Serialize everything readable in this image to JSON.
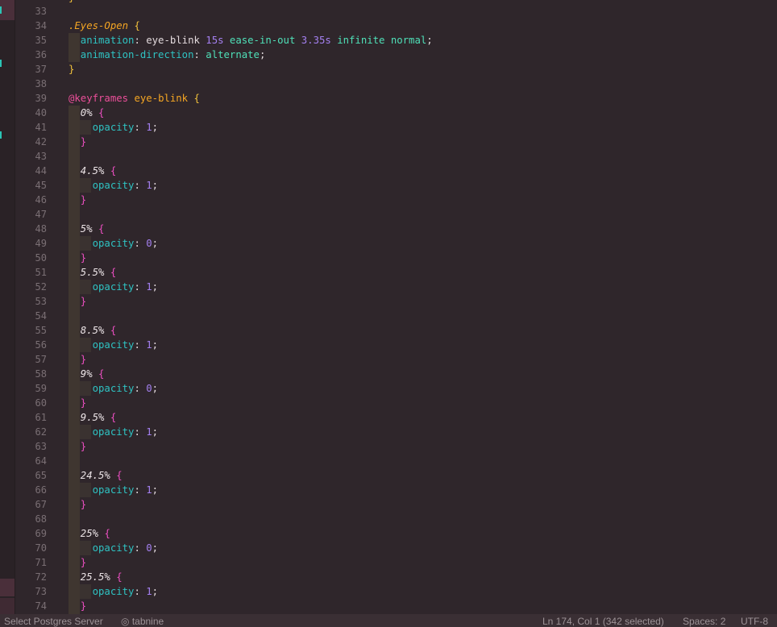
{
  "editor": {
    "lines": [
      {
        "n": "33",
        "tokens": []
      },
      {
        "n": "34",
        "tokens": [
          {
            "t": ".Eyes-Open",
            "c": "sel"
          },
          {
            "t": " ",
            "c": "plain"
          },
          {
            "t": "{",
            "c": "brace-y"
          }
        ]
      },
      {
        "n": "35",
        "tokens": [
          {
            "t": "  animation",
            "c": "prop"
          },
          {
            "t": ": ",
            "c": "punct"
          },
          {
            "t": "eye-blink ",
            "c": "plain"
          },
          {
            "t": "15s",
            "c": "num"
          },
          {
            "t": " ",
            "c": "plain"
          },
          {
            "t": "ease-in-out",
            "c": "kw"
          },
          {
            "t": " ",
            "c": "plain"
          },
          {
            "t": "3.35s",
            "c": "num"
          },
          {
            "t": " ",
            "c": "plain"
          },
          {
            "t": "infinite",
            "c": "kw"
          },
          {
            "t": " ",
            "c": "plain"
          },
          {
            "t": "normal",
            "c": "kw"
          },
          {
            "t": ";",
            "c": "punct"
          }
        ]
      },
      {
        "n": "36",
        "tokens": [
          {
            "t": "  animation-direction",
            "c": "prop"
          },
          {
            "t": ": ",
            "c": "punct"
          },
          {
            "t": "alternate",
            "c": "kw"
          },
          {
            "t": ";",
            "c": "punct"
          }
        ]
      },
      {
        "n": "37",
        "tokens": [
          {
            "t": "}",
            "c": "brace-y"
          }
        ]
      },
      {
        "n": "38",
        "tokens": []
      },
      {
        "n": "39",
        "tokens": [
          {
            "t": "@keyframes",
            "c": "at"
          },
          {
            "t": " ",
            "c": "plain"
          },
          {
            "t": "eye-blink",
            "c": "name"
          },
          {
            "t": " ",
            "c": "plain"
          },
          {
            "t": "{",
            "c": "brace-y"
          }
        ]
      },
      {
        "n": "40",
        "tokens": [
          {
            "t": "  0",
            "c": "pct"
          },
          {
            "t": "%",
            "c": "pct-sym"
          },
          {
            "t": " ",
            "c": "plain"
          },
          {
            "t": "{",
            "c": "brace-p"
          }
        ]
      },
      {
        "n": "41",
        "tokens": [
          {
            "t": "    opacity",
            "c": "prop"
          },
          {
            "t": ": ",
            "c": "punct"
          },
          {
            "t": "1",
            "c": "num"
          },
          {
            "t": ";",
            "c": "punct"
          }
        ]
      },
      {
        "n": "42",
        "tokens": [
          {
            "t": "  }",
            "c": "brace-p"
          }
        ]
      },
      {
        "n": "43",
        "tokens": []
      },
      {
        "n": "44",
        "tokens": [
          {
            "t": "  4.5",
            "c": "pct"
          },
          {
            "t": "%",
            "c": "pct-sym"
          },
          {
            "t": " ",
            "c": "plain"
          },
          {
            "t": "{",
            "c": "brace-p"
          }
        ]
      },
      {
        "n": "45",
        "tokens": [
          {
            "t": "    opacity",
            "c": "prop"
          },
          {
            "t": ": ",
            "c": "punct"
          },
          {
            "t": "1",
            "c": "num"
          },
          {
            "t": ";",
            "c": "punct"
          }
        ]
      },
      {
        "n": "46",
        "tokens": [
          {
            "t": "  }",
            "c": "brace-p"
          }
        ]
      },
      {
        "n": "47",
        "tokens": []
      },
      {
        "n": "48",
        "tokens": [
          {
            "t": "  5",
            "c": "pct"
          },
          {
            "t": "%",
            "c": "pct-sym"
          },
          {
            "t": " ",
            "c": "plain"
          },
          {
            "t": "{",
            "c": "brace-p"
          }
        ]
      },
      {
        "n": "49",
        "tokens": [
          {
            "t": "    opacity",
            "c": "prop"
          },
          {
            "t": ": ",
            "c": "punct"
          },
          {
            "t": "0",
            "c": "num"
          },
          {
            "t": ";",
            "c": "punct"
          }
        ]
      },
      {
        "n": "50",
        "tokens": [
          {
            "t": "  }",
            "c": "brace-p"
          }
        ]
      },
      {
        "n": "51",
        "tokens": [
          {
            "t": "  5.5",
            "c": "pct"
          },
          {
            "t": "%",
            "c": "pct-sym"
          },
          {
            "t": " ",
            "c": "plain"
          },
          {
            "t": "{",
            "c": "brace-p"
          }
        ]
      },
      {
        "n": "52",
        "tokens": [
          {
            "t": "    opacity",
            "c": "prop"
          },
          {
            "t": ": ",
            "c": "punct"
          },
          {
            "t": "1",
            "c": "num"
          },
          {
            "t": ";",
            "c": "punct"
          }
        ]
      },
      {
        "n": "53",
        "tokens": [
          {
            "t": "  }",
            "c": "brace-p"
          }
        ]
      },
      {
        "n": "54",
        "tokens": []
      },
      {
        "n": "55",
        "tokens": [
          {
            "t": "  8.5",
            "c": "pct"
          },
          {
            "t": "%",
            "c": "pct-sym"
          },
          {
            "t": " ",
            "c": "plain"
          },
          {
            "t": "{",
            "c": "brace-p"
          }
        ]
      },
      {
        "n": "56",
        "tokens": [
          {
            "t": "    opacity",
            "c": "prop"
          },
          {
            "t": ": ",
            "c": "punct"
          },
          {
            "t": "1",
            "c": "num"
          },
          {
            "t": ";",
            "c": "punct"
          }
        ]
      },
      {
        "n": "57",
        "tokens": [
          {
            "t": "  }",
            "c": "brace-p"
          }
        ]
      },
      {
        "n": "58",
        "tokens": [
          {
            "t": "  9",
            "c": "pct"
          },
          {
            "t": "%",
            "c": "pct-sym"
          },
          {
            "t": " ",
            "c": "plain"
          },
          {
            "t": "{",
            "c": "brace-p"
          }
        ]
      },
      {
        "n": "59",
        "tokens": [
          {
            "t": "    opacity",
            "c": "prop"
          },
          {
            "t": ": ",
            "c": "punct"
          },
          {
            "t": "0",
            "c": "num"
          },
          {
            "t": ";",
            "c": "punct"
          }
        ]
      },
      {
        "n": "60",
        "tokens": [
          {
            "t": "  }",
            "c": "brace-p"
          }
        ]
      },
      {
        "n": "61",
        "tokens": [
          {
            "t": "  9.5",
            "c": "pct"
          },
          {
            "t": "%",
            "c": "pct-sym"
          },
          {
            "t": " ",
            "c": "plain"
          },
          {
            "t": "{",
            "c": "brace-p"
          }
        ]
      },
      {
        "n": "62",
        "tokens": [
          {
            "t": "    opacity",
            "c": "prop"
          },
          {
            "t": ": ",
            "c": "punct"
          },
          {
            "t": "1",
            "c": "num"
          },
          {
            "t": ";",
            "c": "punct"
          }
        ]
      },
      {
        "n": "63",
        "tokens": [
          {
            "t": "  }",
            "c": "brace-p"
          }
        ]
      },
      {
        "n": "64",
        "tokens": []
      },
      {
        "n": "65",
        "tokens": [
          {
            "t": "  24.5",
            "c": "pct"
          },
          {
            "t": "%",
            "c": "pct-sym"
          },
          {
            "t": " ",
            "c": "plain"
          },
          {
            "t": "{",
            "c": "brace-p"
          }
        ]
      },
      {
        "n": "66",
        "tokens": [
          {
            "t": "    opacity",
            "c": "prop"
          },
          {
            "t": ": ",
            "c": "punct"
          },
          {
            "t": "1",
            "c": "num"
          },
          {
            "t": ";",
            "c": "punct"
          }
        ]
      },
      {
        "n": "67",
        "tokens": [
          {
            "t": "  }",
            "c": "brace-p"
          }
        ]
      },
      {
        "n": "68",
        "tokens": []
      },
      {
        "n": "69",
        "tokens": [
          {
            "t": "  25",
            "c": "pct"
          },
          {
            "t": "%",
            "c": "pct-sym"
          },
          {
            "t": " ",
            "c": "plain"
          },
          {
            "t": "{",
            "c": "brace-p"
          }
        ]
      },
      {
        "n": "70",
        "tokens": [
          {
            "t": "    opacity",
            "c": "prop"
          },
          {
            "t": ": ",
            "c": "punct"
          },
          {
            "t": "0",
            "c": "num"
          },
          {
            "t": ";",
            "c": "punct"
          }
        ]
      },
      {
        "n": "71",
        "tokens": [
          {
            "t": "  }",
            "c": "brace-p"
          }
        ]
      },
      {
        "n": "72",
        "tokens": [
          {
            "t": "  25.5",
            "c": "pct"
          },
          {
            "t": "%",
            "c": "pct-sym"
          },
          {
            "t": " ",
            "c": "plain"
          },
          {
            "t": "{",
            "c": "brace-p"
          }
        ]
      },
      {
        "n": "73",
        "tokens": [
          {
            "t": "    opacity",
            "c": "prop"
          },
          {
            "t": ": ",
            "c": "punct"
          },
          {
            "t": "1",
            "c": "num"
          },
          {
            "t": ";",
            "c": "punct"
          }
        ]
      },
      {
        "n": "74",
        "tokens": [
          {
            "t": "  }",
            "c": "brace-p"
          }
        ]
      }
    ],
    "top_partial_brace": "}"
  },
  "statusbar": {
    "db_server": "Select Postgres Server",
    "tabnine": "tabnine",
    "tabnine_icon": "tabnine-icon",
    "cursor": "Ln 174, Col 1 (342 selected)",
    "spaces": "Spaces: 2",
    "encoding": "UTF-8"
  },
  "colors": {
    "background": "#2f262b",
    "selector": "#f5a623",
    "property": "#2fc3c3",
    "number": "#a480f0",
    "keyword": "#4fe0b8",
    "at_rule": "#ec4f9a",
    "brace_outer": "#f2c23c",
    "brace_inner": "#ec4fc2",
    "line_number": "#7a6f74",
    "statusbar": "#3a2f34"
  }
}
